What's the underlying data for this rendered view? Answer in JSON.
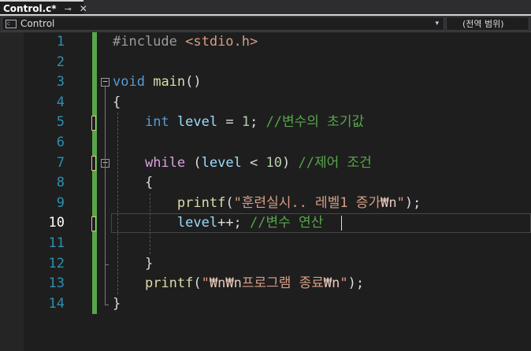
{
  "tab": {
    "title": "Control.c*",
    "pin_icon": "⊸",
    "close_icon": "✕"
  },
  "navbar": {
    "scope_label": "Control",
    "scope_dropdown_icon": "▾",
    "member_label": "(전역 범위)"
  },
  "editor": {
    "current_line": 10,
    "lines": [
      {
        "num": "1",
        "tokens": [
          {
            "t": "#include ",
            "c": "pp"
          },
          {
            "t": "<stdio.h>",
            "c": "str"
          }
        ]
      },
      {
        "num": "2",
        "tokens": []
      },
      {
        "num": "3",
        "tokens": [
          {
            "t": "void",
            "c": "kw"
          },
          {
            "t": " ",
            "c": "pl"
          },
          {
            "t": "main",
            "c": "fn"
          },
          {
            "t": "()",
            "c": "pl"
          }
        ]
      },
      {
        "num": "4",
        "tokens": [
          {
            "t": "{",
            "c": "pl"
          }
        ]
      },
      {
        "num": "5",
        "tokens": [
          {
            "t": "    ",
            "c": "pl"
          },
          {
            "t": "int",
            "c": "kw"
          },
          {
            "t": " ",
            "c": "pl"
          },
          {
            "t": "level",
            "c": "var"
          },
          {
            "t": " = ",
            "c": "pl"
          },
          {
            "t": "1",
            "c": "num"
          },
          {
            "t": "; ",
            "c": "pl"
          },
          {
            "t": "//변수의 초기값",
            "c": "cm"
          }
        ]
      },
      {
        "num": "6",
        "tokens": []
      },
      {
        "num": "7",
        "tokens": [
          {
            "t": "    ",
            "c": "pl"
          },
          {
            "t": "while",
            "c": "ctl"
          },
          {
            "t": " (",
            "c": "pl"
          },
          {
            "t": "level",
            "c": "var"
          },
          {
            "t": " < ",
            "c": "pl"
          },
          {
            "t": "10",
            "c": "num"
          },
          {
            "t": ") ",
            "c": "pl"
          },
          {
            "t": "//제어 조건",
            "c": "cm"
          }
        ]
      },
      {
        "num": "8",
        "tokens": [
          {
            "t": "    {",
            "c": "pl"
          }
        ]
      },
      {
        "num": "9",
        "tokens": [
          {
            "t": "        ",
            "c": "pl"
          },
          {
            "t": "printf",
            "c": "fn"
          },
          {
            "t": "(",
            "c": "pl"
          },
          {
            "t": "\"훈련실시.. 레벨1 증가",
            "c": "str"
          },
          {
            "t": "₩n",
            "c": "esc"
          },
          {
            "t": "\"",
            "c": "str"
          },
          {
            "t": ");",
            "c": "pl"
          }
        ]
      },
      {
        "num": "10",
        "tokens": [
          {
            "t": "        ",
            "c": "pl"
          },
          {
            "t": "level",
            "c": "var"
          },
          {
            "t": "++; ",
            "c": "pl"
          },
          {
            "t": "//변수 연산",
            "c": "cm"
          }
        ]
      },
      {
        "num": "11",
        "tokens": []
      },
      {
        "num": "12",
        "tokens": [
          {
            "t": "    }",
            "c": "pl"
          }
        ]
      },
      {
        "num": "13",
        "tokens": [
          {
            "t": "    ",
            "c": "pl"
          },
          {
            "t": "printf",
            "c": "fn"
          },
          {
            "t": "(",
            "c": "pl"
          },
          {
            "t": "\"",
            "c": "str"
          },
          {
            "t": "₩n₩n",
            "c": "esc"
          },
          {
            "t": "프로그램 종료",
            "c": "str"
          },
          {
            "t": "₩n",
            "c": "esc"
          },
          {
            "t": "\"",
            "c": "str"
          },
          {
            "t": ");",
            "c": "pl"
          }
        ]
      },
      {
        "num": "14",
        "tokens": [
          {
            "t": "}",
            "c": "pl"
          }
        ]
      }
    ],
    "fold_icon": "−",
    "token_colors": {
      "pp": "#9b9b9b",
      "str": "#d69d85",
      "kw": "#569cd6",
      "ctl": "#d8a0df",
      "fn": "#dcdcaa",
      "var": "#9cdcfe",
      "num": "#b5cea8",
      "cm": "#57a64a",
      "pl": "#dcdcdc",
      "esc": "#e8c9bb"
    },
    "change_bar_color": "#57a64a",
    "unsaved_mark_color": "#e5c07b"
  }
}
